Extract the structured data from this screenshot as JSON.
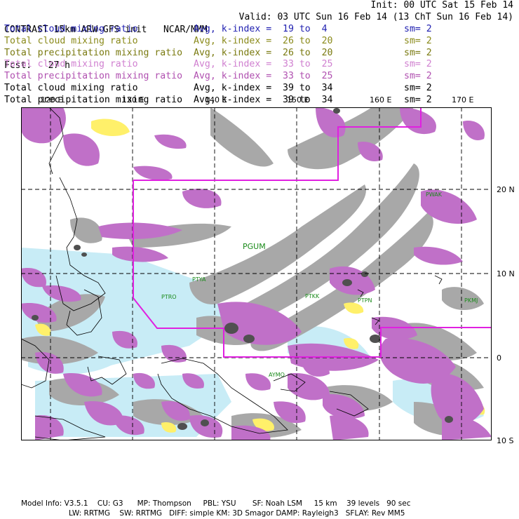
{
  "header": {
    "title": "CONTRAST 15km ARW-GFS init",
    "org": "NCAR/MMM",
    "init": "Init: 00 UTC Sat 15 Feb 14",
    "fcst_label": "Fcst:",
    "fcst_value": "27 h",
    "valid": "Valid: 03 UTC Sun 16 Feb 14 (13 ChT Sun 16 Feb 14)"
  },
  "fields": [
    {
      "name": "Total cloud mixing ratio",
      "avg": "Avg, k-index =  19 to  4",
      "sm": "sm= 2",
      "color": "#1f1fb0"
    },
    {
      "name": "Total cloud mixing ratio",
      "avg": "Avg, k-index =  26 to  20",
      "sm": "sm= 2",
      "color": "#8a8a1a"
    },
    {
      "name": "Total precipitation mixing ratio",
      "avg": "Avg, k-index =  26 to  20",
      "sm": "sm= 2",
      "color": "#7a7a10"
    },
    {
      "name": "Total cloud mixing ratio",
      "avg": "Avg, k-index =  33 to  25",
      "sm": "sm= 2",
      "color": "#d080d0"
    },
    {
      "name": "Total precipitation mixing ratio",
      "avg": "Avg, k-index =  33 to  25",
      "sm": "sm= 2",
      "color": "#b050b0"
    },
    {
      "name": "Total cloud mixing ratio",
      "avg": "Avg, k-index =  39 to  34",
      "sm": "sm= 2",
      "color": "#000000"
    },
    {
      "name": "Total precipitation mixing ratio",
      "avg": "Avg, k-index =  39 to  34",
      "sm": "sm= 2",
      "color": "#000000"
    }
  ],
  "axes": {
    "lon_labels": [
      "120 E",
      "130 E",
      "140 E",
      "150 E",
      "160 E",
      "170 E"
    ],
    "lat_labels": [
      "20 N",
      "10 N",
      "0",
      "10 S"
    ]
  },
  "stations": [
    {
      "id": "PWAK",
      "color": "#1a8a1a"
    },
    {
      "id": "PGUM",
      "color": "#1a8a1a"
    },
    {
      "id": "PTYA",
      "color": "#1a8a1a"
    },
    {
      "id": "PTRO",
      "color": "#1a8a1a"
    },
    {
      "id": "PTKK",
      "color": "#1a8a1a"
    },
    {
      "id": "PTPN",
      "color": "#1a8a1a"
    },
    {
      "id": "PKMJ",
      "color": "#1a8a1a"
    },
    {
      "id": "AYMO",
      "color": "#1a8a1a"
    }
  ],
  "colors": {
    "cloud_low": "#c8ecf6",
    "cloud_mid": "#fff06a",
    "cloud_upper": "#c070c8",
    "cloud_high": "#a8a8a8",
    "precip_core": "#505050",
    "domain_box": "#e020e0",
    "grid": "#000000",
    "coast": "#000000"
  },
  "footer": {
    "line1": "Model Info: V3.5.1    CU: G3      MP: Thompson     PBL: YSU       SF: Noah LSM     15 km    39 levels   90 sec",
    "line2": "LW: RRTMG    SW: RRTMG   DIFF: simple KM: 3D Smagor DAMP: Rayleigh3   SFLAY: Rev MM5"
  }
}
